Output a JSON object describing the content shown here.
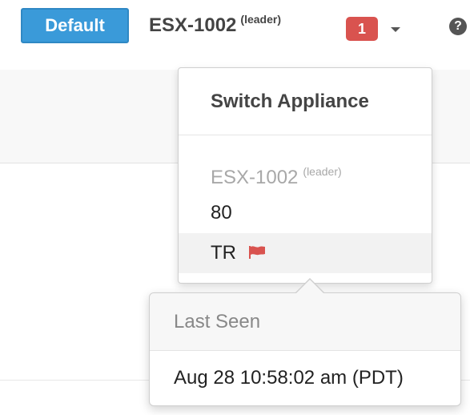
{
  "header": {
    "view_button": "Default",
    "appliance_name": "ESX-1002",
    "appliance_role": "(leader)",
    "alert_count": "1",
    "help_glyph": "?"
  },
  "dropdown": {
    "title": "Switch Appliance",
    "current": {
      "name": "ESX-1002",
      "role": "(leader)"
    },
    "items": [
      {
        "label": "80",
        "flagged": false
      },
      {
        "label": "TR",
        "flagged": true,
        "flag_icon": "flag-icon"
      }
    ]
  },
  "tooltip": {
    "title": "Last Seen",
    "value": "Aug 28 10:58:02 am (PDT)"
  },
  "colors": {
    "accent": "#3a9ad9",
    "badge": "#d9534f",
    "flag": "#d9534f",
    "muted_text": "#a8a8a8"
  }
}
